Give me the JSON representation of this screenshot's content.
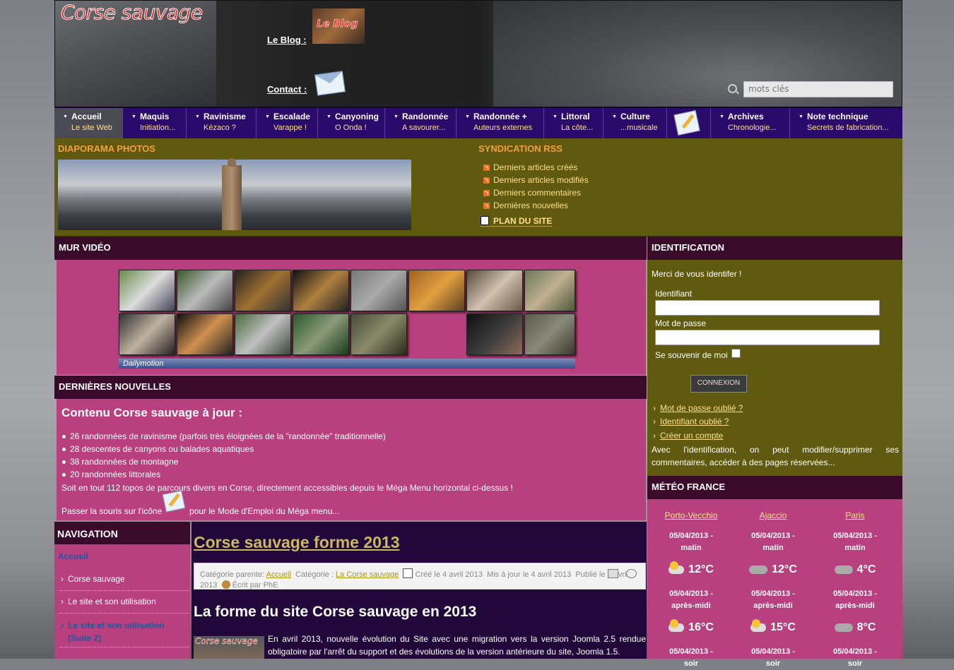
{
  "header": {
    "logo_text": "Corse sauvage",
    "blog_label": "Le Blog :",
    "blog_thumb_text": "Le Blog",
    "contact_label": "Contact :",
    "search_placeholder": "mots clés"
  },
  "menu": [
    {
      "title": "Accueil",
      "sub": "Le site Web"
    },
    {
      "title": "Maquis",
      "sub": "Initiation..."
    },
    {
      "title": "Ravinisme",
      "sub": "Kézaco ?"
    },
    {
      "title": "Escalade",
      "sub": "Varappe !"
    },
    {
      "title": "Canyoning",
      "sub": "O Onda !"
    },
    {
      "title": "Randonnée",
      "sub": "A savourer..."
    },
    {
      "title": "Randonnée +",
      "sub": "Auteurs externes"
    },
    {
      "title": "Littoral",
      "sub": "La côte..."
    },
    {
      "title": "Culture",
      "sub": "...musicale"
    },
    {
      "title": "Archives",
      "sub": "Chronologie..."
    },
    {
      "title": "Note technique",
      "sub": "Secrets de fabrication..."
    }
  ],
  "diaporama": {
    "title": "DIAPORAMA PHOTOS"
  },
  "syndication": {
    "title": "SYNDICATION RSS",
    "items": [
      "Derniers articles créés",
      "Derniers articles modifiés",
      "Derniers commentaires",
      "Dernières nouvelles"
    ],
    "plan": "PLAN DU SITE"
  },
  "mur_video": {
    "title": "MUR VIDÉO",
    "brand": "Dailymotion"
  },
  "nouvelles": {
    "title": "DERNIÈRES NOUVELLES",
    "heading": "Contenu Corse sauvage à jour :",
    "items": [
      "26 randonnées de ravinisme (parfois très éloignées de la \"randonnée\" traditionnelle)",
      "28 descentes de canyons ou balades aquatiques",
      "38 randonnées de montagne",
      "20 randonnées littorales"
    ],
    "summary": "Soit en tout 112 topos de parcours divers en Corse, directement accessibles depuis le Méga Menu horizontal ci-dessus !",
    "help_before": "Passer la souris sur l'icône",
    "help_after": "pour le Mode d'Emploi du Méga menu..."
  },
  "identification": {
    "title": "IDENTIFICATION",
    "intro": "Merci de vous identifer !",
    "user_label": "Identifiant",
    "pass_label": "Mot de passe",
    "remember_label": "Se souvenir de moi",
    "button": "CONNEXION",
    "links": [
      "Mot de passe oublié ?",
      "Identifiant oublié ?",
      "Créer un compte"
    ],
    "text": "Avec l'identification, on peut modifier/supprimer ses commentaires, accéder à des pages réservées..."
  },
  "meteo": {
    "title": "MÉTÉO FRANCE",
    "cities": [
      {
        "name": "Porto-Vecchio",
        "rows": [
          {
            "date": "05/04/2013 -",
            "period": "matin",
            "temp": "12°C",
            "icon": "sun-cloud-icon"
          },
          {
            "date": "05/04/2013 -",
            "period": "après-midi",
            "temp": "16°C",
            "icon": "sun-cloud-icon"
          },
          {
            "date": "05/04/2013 -",
            "period": "soir"
          }
        ]
      },
      {
        "name": "Ajaccio",
        "rows": [
          {
            "date": "05/04/2013 -",
            "period": "matin",
            "temp": "12°C",
            "icon": "rain-icon"
          },
          {
            "date": "05/04/2013 -",
            "period": "après-midi",
            "temp": "15°C",
            "icon": "sun-cloud-icon"
          },
          {
            "date": "05/04/2013 -",
            "period": "soir"
          }
        ]
      },
      {
        "name": "Paris",
        "rows": [
          {
            "date": "05/04/2013 -",
            "period": "matin",
            "temp": "4°C",
            "icon": "cloud-icon"
          },
          {
            "date": "05/04/2013 -",
            "period": "après-midi",
            "temp": "8°C",
            "icon": "cloud-icon"
          },
          {
            "date": "05/04/2013 -",
            "period": "soir"
          }
        ]
      }
    ]
  },
  "navigation": {
    "title": "NAVIGATION",
    "active": "Accueil",
    "items": [
      "Corse sauvage",
      "Le site et son utilisation",
      "Le site et son utilisation (Suite 2)"
    ]
  },
  "article": {
    "title": "Corse sauvage forme 2013",
    "meta_parent_label": "Catégorie parente:",
    "meta_parent": "Accueil",
    "meta_cat_label": "Catégorie :",
    "meta_cat": "La Corse sauvage",
    "meta_created": "Créé le 4 avril 2013",
    "meta_updated": "Mis à jour le 4 avril 2013",
    "meta_published": "Publié le 4 avril 2013",
    "meta_author": "Écrit par PhE",
    "heading": "La forme du site Corse sauvage en 2013",
    "thumb_text": "Corse sauvage",
    "text": "En avril 2013, nouvelle évolution du Site avec une migration vers la version Joomla 2.5 rendue obligatoire par l'arrêt du support et des évolutions de la version antérieure du site, Joomla 1.5."
  }
}
